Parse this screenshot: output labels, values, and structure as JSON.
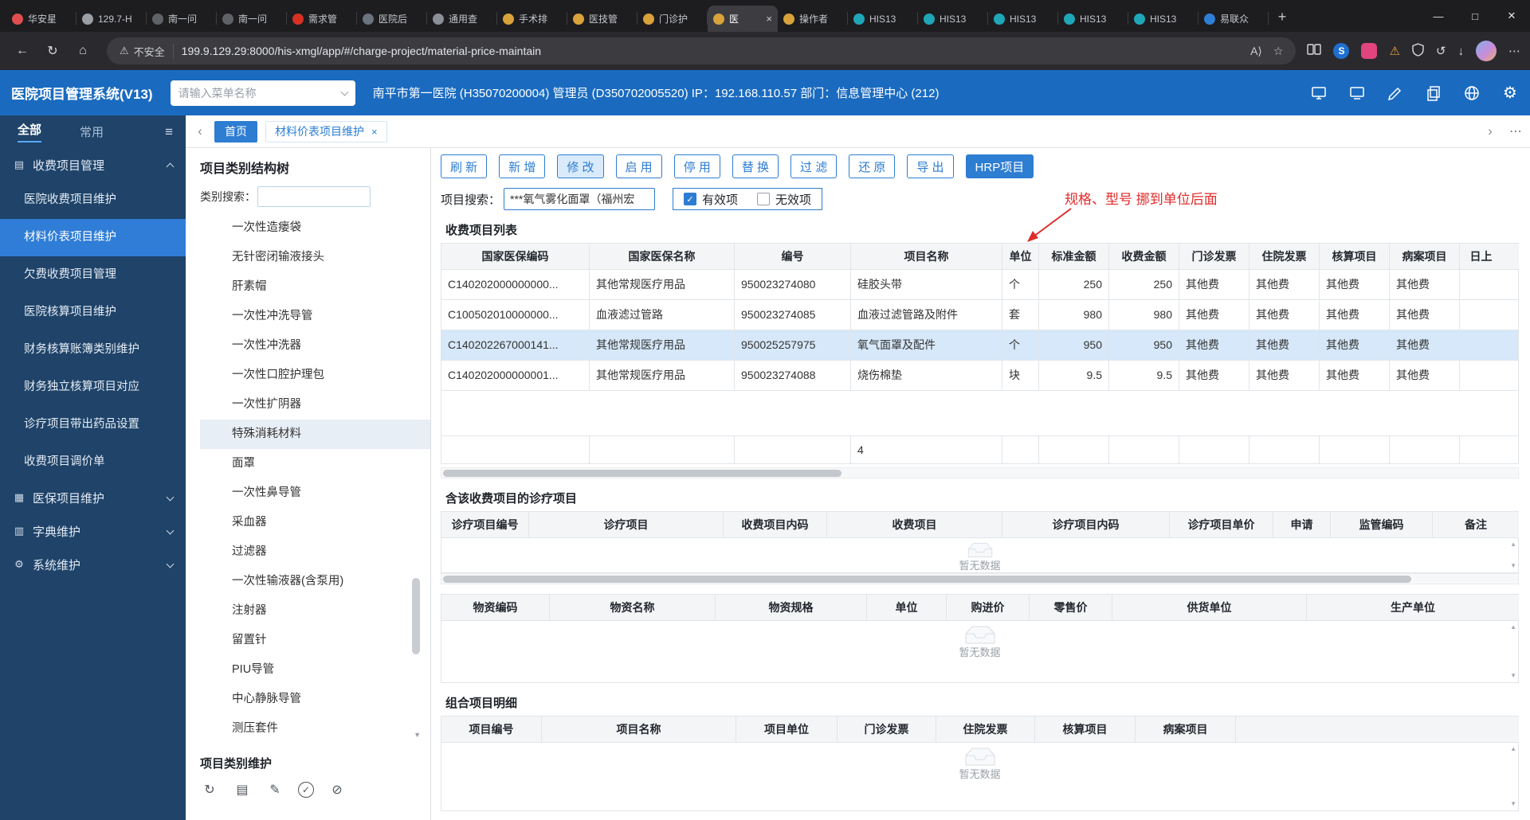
{
  "browser": {
    "tabs": [
      {
        "title": "华安星",
        "color": "#e04f4f"
      },
      {
        "title": "129.7-H",
        "color": "#9aa0a6"
      },
      {
        "title": "南一问",
        "color": "#5f6368"
      },
      {
        "title": "南一问",
        "color": "#5f6368"
      },
      {
        "title": "需求管",
        "color": "#d93025"
      },
      {
        "title": "医院后",
        "color": "#6b7280"
      },
      {
        "title": "通用查",
        "color": "#8a8f98"
      },
      {
        "title": "手术排",
        "color": "#d9a23a"
      },
      {
        "title": "医技管",
        "color": "#d9a23a"
      },
      {
        "title": "门诊护",
        "color": "#d9a23a"
      },
      {
        "title": "医",
        "color": "#d9a23a",
        "active": true
      },
      {
        "title": "操作者",
        "color": "#d9a23a"
      },
      {
        "title": "HIS13",
        "color": "#1fa7b8"
      },
      {
        "title": "HIS13",
        "color": "#1fa7b8"
      },
      {
        "title": "HIS13",
        "color": "#1fa7b8"
      },
      {
        "title": "HIS13",
        "color": "#1fa7b8"
      },
      {
        "title": "HIS13",
        "color": "#1fa7b8"
      },
      {
        "title": "易联众",
        "color": "#2f7fd6"
      }
    ],
    "security_label": "不安全",
    "url": "199.9.129.29:8000/his-xmgl/app/#/charge-project/material-price-maintain",
    "read_aloud_glyph": "A⟩",
    "extension_badge_text": "S"
  },
  "header": {
    "title": "医院项目管理系统(V13)",
    "menu_search_placeholder": "请输入菜单名称",
    "user_info": "南平市第一医院 (H35070200004) 管理员 (D350702005520) IP：192.168.110.57 部门：信息管理中心 (212)"
  },
  "sidebar": {
    "tab_all": "全部",
    "tab_common": "常用",
    "section_charge": "收费项目管理",
    "items": [
      {
        "label": "医院收费项目维护"
      },
      {
        "label": "材料价表项目维护",
        "selected": true
      },
      {
        "label": "欠费收费项目管理"
      },
      {
        "label": "医院核算项目维护"
      },
      {
        "label": "财务核算账簿类别维护"
      },
      {
        "label": "财务独立核算项目对应"
      },
      {
        "label": "诊疗项目带出药品设置"
      },
      {
        "label": "收费项目调价单"
      }
    ],
    "section_insurance": "医保项目维护",
    "section_dict": "字典维护",
    "section_system": "系统维护"
  },
  "workspace": {
    "tab_home": "首页",
    "tab_current": "材料价表项目维护"
  },
  "tree": {
    "title": "项目类别结构树",
    "search_label": "类别搜索：",
    "items": [
      {
        "label": "一次性造瘘袋"
      },
      {
        "label": "无针密闭输液接头"
      },
      {
        "label": "肝素帽"
      },
      {
        "label": "一次性冲洗导管"
      },
      {
        "label": "一次性冲洗器"
      },
      {
        "label": "一次性口腔护理包"
      },
      {
        "label": "一次性扩阴器"
      },
      {
        "label": "特殊消耗材料",
        "selected": true
      },
      {
        "label": "面罩"
      },
      {
        "label": "一次性鼻导管"
      },
      {
        "label": "采血器"
      },
      {
        "label": "过滤器"
      },
      {
        "label": "一次性输液器(含泵用)"
      },
      {
        "label": "注射器"
      },
      {
        "label": "留置针"
      },
      {
        "label": "PIU导管"
      },
      {
        "label": "中心静脉导管"
      },
      {
        "label": "测压套件"
      }
    ],
    "footer_title": "项目类别维护"
  },
  "toolbar": {
    "buttons": [
      {
        "label": "刷 新"
      },
      {
        "label": "新 增"
      },
      {
        "label": "修 改",
        "active": true
      },
      {
        "label": "启 用"
      },
      {
        "label": "停 用"
      },
      {
        "label": "替 换"
      },
      {
        "label": "过 滤"
      },
      {
        "label": "还 原"
      },
      {
        "label": "导 出"
      },
      {
        "label": "HRP项目",
        "primary": true
      }
    ],
    "search_label": "项目搜索：",
    "search_value": "***氧气雾化面罩（福州宏",
    "valid_label": "有效项",
    "invalid_label": "无效项",
    "annotation": "规格、型号 挪到单位后面"
  },
  "charge_table": {
    "title": "收费项目列表",
    "columns": [
      "国家医保编码",
      "国家医保名称",
      "编号",
      "项目名称",
      "单位",
      "标准金额",
      "收费金额",
      "门诊发票",
      "住院发票",
      "核算项目",
      "病案项目",
      "日上"
    ],
    "rows": [
      {
        "code": "C140202000000000...",
        "ins_name": "其他常规医疗用品",
        "num": "950023274080",
        "name": "硅胶头带",
        "unit": "个",
        "std": "250",
        "fee": "250",
        "opi": "其他费",
        "ipi": "其他费",
        "acct": "其他费",
        "rec": "其他费"
      },
      {
        "code": "C100502010000000...",
        "ins_name": "血液滤过管路",
        "num": "950023274085",
        "name": "血液过滤管路及附件",
        "unit": "套",
        "std": "980",
        "fee": "980",
        "opi": "其他费",
        "ipi": "其他费",
        "acct": "其他费",
        "rec": "其他费"
      },
      {
        "code": "C140202267000141...",
        "ins_name": "其他常规医疗用品",
        "num": "950025257975",
        "name": "氧气面罩及配件",
        "unit": "个",
        "std": "950",
        "fee": "950",
        "opi": "其他费",
        "ipi": "其他费",
        "acct": "其他费",
        "rec": "其他费",
        "selected": true
      },
      {
        "code": "C140202000000001...",
        "ins_name": "其他常规医疗用品",
        "num": "950023274088",
        "name": "烧伤棉垫",
        "unit": "块",
        "std": "9.5",
        "fee": "9.5",
        "opi": "其他费",
        "ipi": "其他费",
        "acct": "其他费",
        "rec": "其他费"
      }
    ],
    "count": "4"
  },
  "diag_table": {
    "title": "含该收费项目的诊疗项目",
    "columns": [
      "诊疗项目编号",
      "诊疗项目",
      "收费项目内码",
      "收费项目",
      "诊疗项目内码",
      "诊疗项目单价",
      "申请",
      "监管编码",
      "备注"
    ],
    "empty_text": "暂无数据"
  },
  "goods_table": {
    "columns": [
      "物资编码",
      "物资名称",
      "物资规格",
      "单位",
      "购进价",
      "零售价",
      "供货单位",
      "生产单位"
    ],
    "empty_text": "暂无数据"
  },
  "combo_table": {
    "title": "组合项目明细",
    "columns": [
      "项目编号",
      "项目名称",
      "项目单位",
      "门诊发票",
      "住院发票",
      "核算项目",
      "病案项目"
    ],
    "empty_text": "暂无数据"
  },
  "colors": {
    "accent": "#2d7dd2",
    "header_blue": "#1a6bc0",
    "sidebar_bg": "#1f4369",
    "annotation_red": "#e02b2b",
    "selected_row": "#d6e8f9"
  }
}
